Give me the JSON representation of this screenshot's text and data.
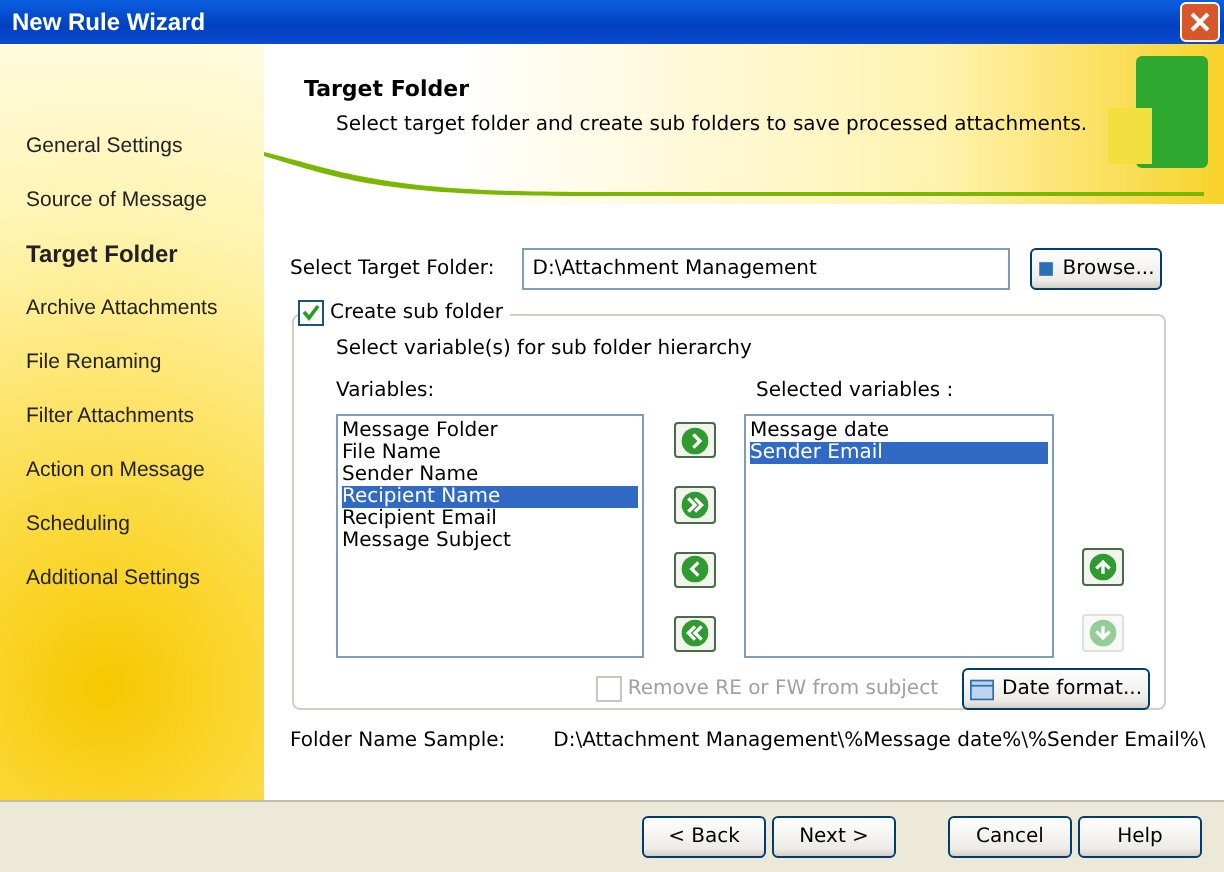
{
  "window": {
    "title": "New Rule Wizard"
  },
  "sidebar": {
    "items": [
      {
        "label": "General Settings",
        "selected": false
      },
      {
        "label": "Source of Message",
        "selected": false
      },
      {
        "label": "Target Folder",
        "selected": true
      },
      {
        "label": "Archive Attachments",
        "selected": false
      },
      {
        "label": "File Renaming",
        "selected": false
      },
      {
        "label": "Filter Attachments",
        "selected": false
      },
      {
        "label": "Action on Message",
        "selected": false
      },
      {
        "label": "Scheduling",
        "selected": false
      },
      {
        "label": "Additional Settings",
        "selected": false
      }
    ]
  },
  "header": {
    "title": "Target Folder",
    "subtitle": "Select target folder and create sub folders to save processed attachments."
  },
  "target_folder": {
    "label": "Select Target Folder:",
    "value": "D:\\Attachment Management",
    "browse_button": "Browse..."
  },
  "sub_folder": {
    "label": "Create sub folder",
    "checked": true,
    "hint": "Select variable(s) for sub folder hierarchy",
    "variables_label": "Variables:",
    "variables": [
      {
        "label": "Message Folder",
        "selected": false
      },
      {
        "label": "File Name",
        "selected": false
      },
      {
        "label": "Sender Name",
        "selected": false
      },
      {
        "label": "Recipient Name",
        "selected": true
      },
      {
        "label": "Recipient Email",
        "selected": false
      },
      {
        "label": "Message Subject",
        "selected": false
      }
    ],
    "selected_label": "Selected variables :",
    "selected_variables": [
      {
        "label": "Message date",
        "selected": false
      },
      {
        "label": "Sender Email",
        "selected": true
      }
    ],
    "move_buttons": [
      {
        "kind": "add",
        "disabled": false
      },
      {
        "kind": "add-all",
        "disabled": false
      },
      {
        "kind": "remove",
        "disabled": false
      },
      {
        "kind": "remove-all",
        "disabled": false
      }
    ],
    "order_buttons": [
      {
        "kind": "up",
        "disabled": false
      },
      {
        "kind": "down",
        "disabled": true
      }
    ],
    "remove_re": {
      "label": "Remove RE or FW from subject",
      "checked": false,
      "disabled": true
    },
    "date_format_button": "Date format..."
  },
  "sample": {
    "label": "Folder Name Sample:",
    "value": "D:\\Attachment Management\\%Message date%\\%Sender Email%\\"
  },
  "buttons": [
    {
      "label": "< Back"
    },
    {
      "label": "Next >"
    },
    {
      "label": "Cancel"
    },
    {
      "label": "Help"
    }
  ]
}
